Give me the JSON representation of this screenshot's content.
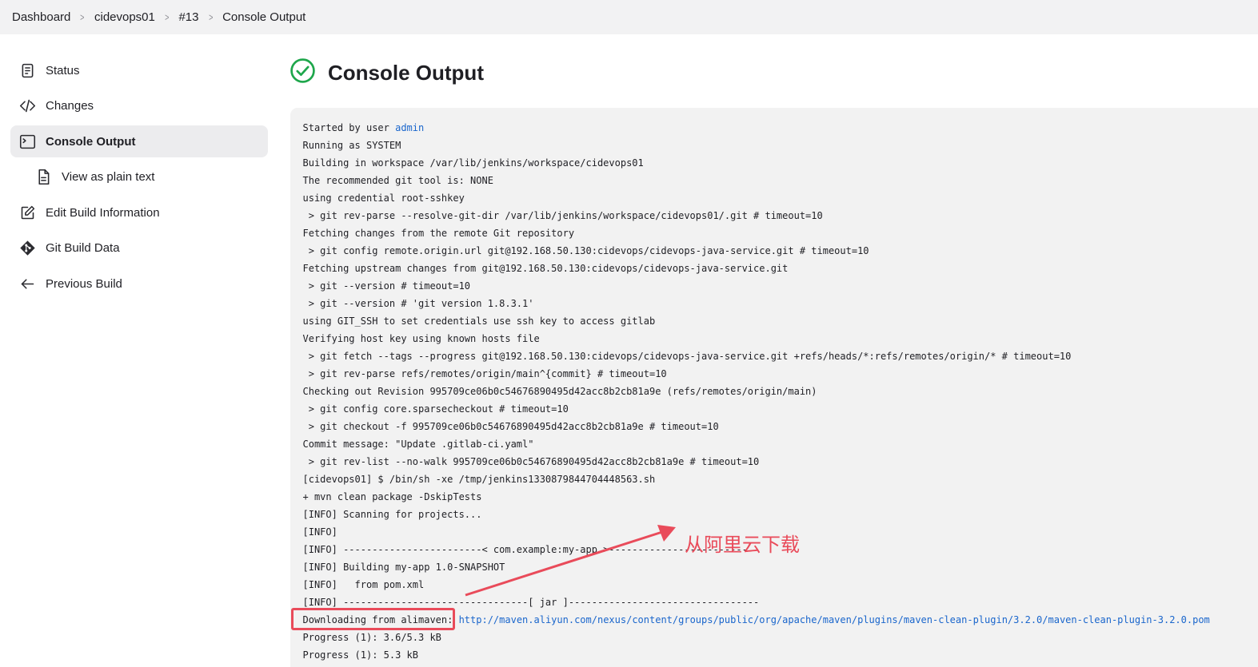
{
  "breadcrumb": [
    "Dashboard",
    "cidevops01",
    "#13",
    "Console Output"
  ],
  "sidebar": {
    "items": [
      {
        "label": "Status",
        "icon": "status-icon"
      },
      {
        "label": "Changes",
        "icon": "code-icon"
      },
      {
        "label": "Console Output",
        "icon": "terminal-icon",
        "active": true
      },
      {
        "label": "View as plain text",
        "icon": "document-icon",
        "sub": true
      },
      {
        "label": "Edit Build Information",
        "icon": "edit-icon"
      },
      {
        "label": "Git Build Data",
        "icon": "git-icon"
      },
      {
        "label": "Previous Build",
        "icon": "arrow-left-icon"
      }
    ]
  },
  "page": {
    "title": "Console Output",
    "status_icon": "success-check-icon",
    "status_color": "#1ea64b"
  },
  "console": {
    "started_prefix": "Started by user ",
    "started_user": "admin",
    "lines": [
      "Running as SYSTEM",
      "Building in workspace /var/lib/jenkins/workspace/cidevops01",
      "The recommended git tool is: NONE",
      "using credential root-sshkey",
      " > git rev-parse --resolve-git-dir /var/lib/jenkins/workspace/cidevops01/.git # timeout=10",
      "Fetching changes from the remote Git repository",
      " > git config remote.origin.url git@192.168.50.130:cidevops/cidevops-java-service.git # timeout=10",
      "Fetching upstream changes from git@192.168.50.130:cidevops/cidevops-java-service.git",
      " > git --version # timeout=10",
      " > git --version # 'git version 1.8.3.1'",
      "using GIT_SSH to set credentials use ssh key to access gitlab",
      "Verifying host key using known hosts file",
      " > git fetch --tags --progress git@192.168.50.130:cidevops/cidevops-java-service.git +refs/heads/*:refs/remotes/origin/* # timeout=10",
      " > git rev-parse refs/remotes/origin/main^{commit} # timeout=10",
      "Checking out Revision 995709ce06b0c54676890495d42acc8b2cb81a9e (refs/remotes/origin/main)",
      " > git config core.sparsecheckout # timeout=10",
      " > git checkout -f 995709ce06b0c54676890495d42acc8b2cb81a9e # timeout=10",
      "Commit message: \"Update .gitlab-ci.yaml\"",
      " > git rev-list --no-walk 995709ce06b0c54676890495d42acc8b2cb81a9e # timeout=10",
      "[cidevops01] $ /bin/sh -xe /tmp/jenkins1330879844704448563.sh",
      "+ mvn clean package -DskipTests",
      "[INFO] Scanning for projects...",
      "[INFO]",
      "[INFO] ------------------------< com.example:my-app >------------------------",
      "[INFO] Building my-app 1.0-SNAPSHOT",
      "[INFO]   from pom.xml",
      "[INFO] --------------------------------[ jar ]---------------------------------"
    ],
    "download_prefix": "Downloading from alimaven: ",
    "download_url": "http://maven.aliyun.com/nexus/content/groups/public/org/apache/maven/plugins/maven-clean-plugin/3.2.0/maven-clean-plugin-3.2.0.pom",
    "lines_after": [
      "Progress (1): 3.6/5.3 kB",
      "Progress (1): 5.3 kB"
    ]
  },
  "annotation": {
    "text": "从阿里云下载",
    "color": "#e94b5a"
  }
}
